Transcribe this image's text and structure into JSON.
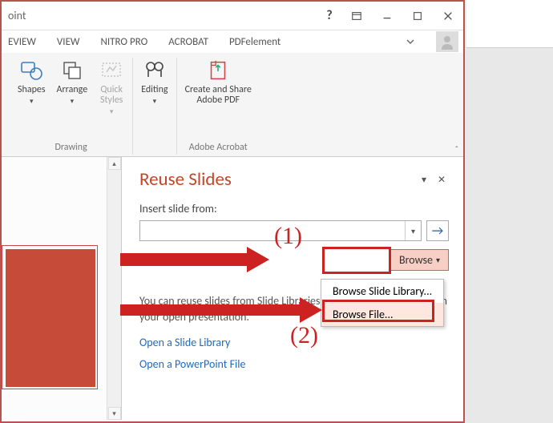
{
  "title": "oint",
  "tabs": [
    "EVIEW",
    "VIEW",
    "NITRO PRO",
    "ACROBAT",
    "PDFelement"
  ],
  "ribbon": {
    "drawing": {
      "label": "Drawing",
      "shapes": "Shapes",
      "arrange": "Arrange",
      "quick_styles": "Quick\nStyles"
    },
    "editing": {
      "label": "Editing",
      "editing_btn": "Editing"
    },
    "acrobat": {
      "label": "Adobe Acrobat",
      "share": "Create and Share\nAdobe PDF"
    }
  },
  "pane": {
    "title": "Reuse Slides",
    "field_label": "Insert slide from:",
    "input_value": "",
    "browse": "Browse",
    "desc": "You can reuse slides from Slide Libraries or other PowerPoint files in your open presentation.",
    "link1": "Open a Slide Library",
    "link2": "Open a PowerPoint File"
  },
  "menu": {
    "item1": "Browse Slide Library...",
    "item2": "Browse File..."
  },
  "anno": {
    "one": "(1)",
    "two": "(2)"
  }
}
